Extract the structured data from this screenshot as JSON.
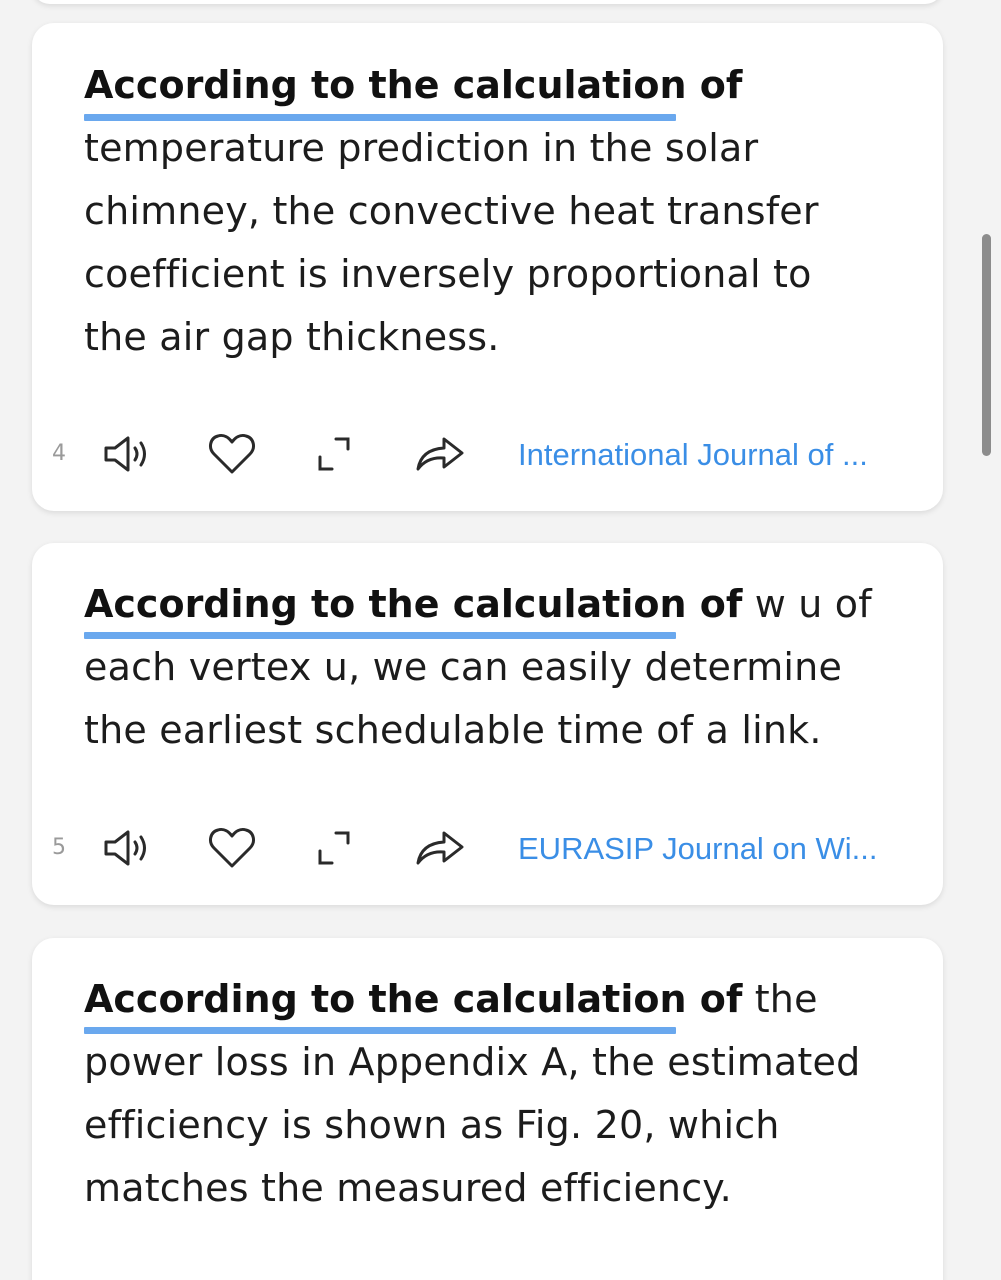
{
  "keyword": "According to the calculation of",
  "results": [
    {
      "index": "4",
      "sentence_rest": "temperature prediction in the solar chimney, the convective heat transfer coefficient is inversely proportional to the air gap thickness.",
      "source": "International Journal of ..."
    },
    {
      "index": "5",
      "sentence_rest": "w u of each vertex u, we can easily determine the earliest schedulable time of a link.",
      "source": "EURASIP Journal on Wi..."
    },
    {
      "sentence_rest": "the power loss in Appendix A, the estimated efficiency is shown as Fig. 20, which matches the measured efficiency."
    }
  ],
  "icons": {
    "speaker": "speaker-icon",
    "heart": "heart-icon",
    "expand": "expand-icon",
    "share": "share-icon"
  },
  "colors": {
    "accent": "#3a8ee6",
    "underline": "#6aa8ee",
    "background": "#f3f3f3",
    "card": "#ffffff",
    "text": "#1c1c1c",
    "icon": "#2a2a2a"
  }
}
